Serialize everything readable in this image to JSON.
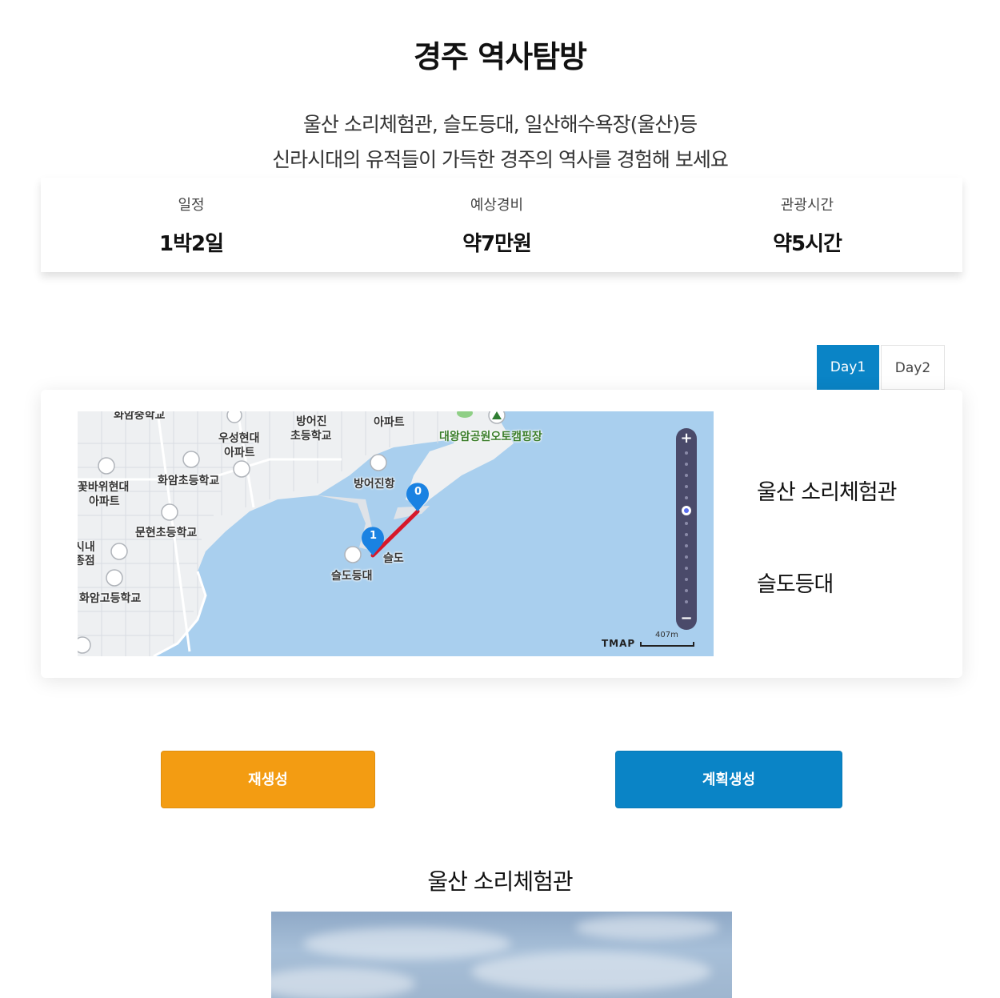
{
  "page": {
    "title": "경주 역사탐방",
    "desc_line1": "울산 소리체험관, 슬도등대, 일산해수욕장(울산)등",
    "desc_line2": "신라시대의 유적들이 가득한 경주의 역사를 경험해 보세요"
  },
  "summary": [
    {
      "label": "일정",
      "value": "1박2일"
    },
    {
      "label": "예상경비",
      "value": "약7만원"
    },
    {
      "label": "관광시간",
      "value": "약5시간"
    }
  ],
  "tabs": [
    {
      "label": "Day1",
      "active": true
    },
    {
      "label": "Day2",
      "active": false
    }
  ],
  "map": {
    "labels": {
      "school_top": "화암중학교",
      "apt_top_right": "아파트",
      "bangeojin_school_1": "방어진",
      "bangeojin_school_2": "초등학교",
      "woosung_apt_1": "우성현대",
      "woosung_apt_2": "아파트",
      "campground": "대왕암공원오토캠핑장",
      "flower_apt_1": "꽃바위현대",
      "flower_apt_2": "아파트",
      "hwaam_elementary": "화암초등학교",
      "bangeojin_port": "방어진항",
      "munhyeon_school": "문현초등학교",
      "city_1": "시내",
      "city_2": "종점",
      "seuldo": "슬도",
      "seuldo_lighthouse": "슬도등대",
      "hwaam_high": "화암고등학교"
    },
    "markers": [
      "0",
      "1"
    ],
    "brand": "TMAP",
    "scale": "407m",
    "zoom_plus": "+",
    "zoom_minus": "−",
    "route_color": "#d7182a",
    "zoom_level_fraction": 0.4
  },
  "stops": [
    "울산 소리체험관",
    "슬도등대"
  ],
  "buttons": {
    "regenerate": "재생성",
    "create_plan": "계획생성"
  },
  "place": {
    "title": "울산 소리체험관"
  },
  "colors": {
    "accent_blue": "#0a84c6",
    "accent_orange": "#f39c12",
    "sea": "#a9cfee"
  }
}
